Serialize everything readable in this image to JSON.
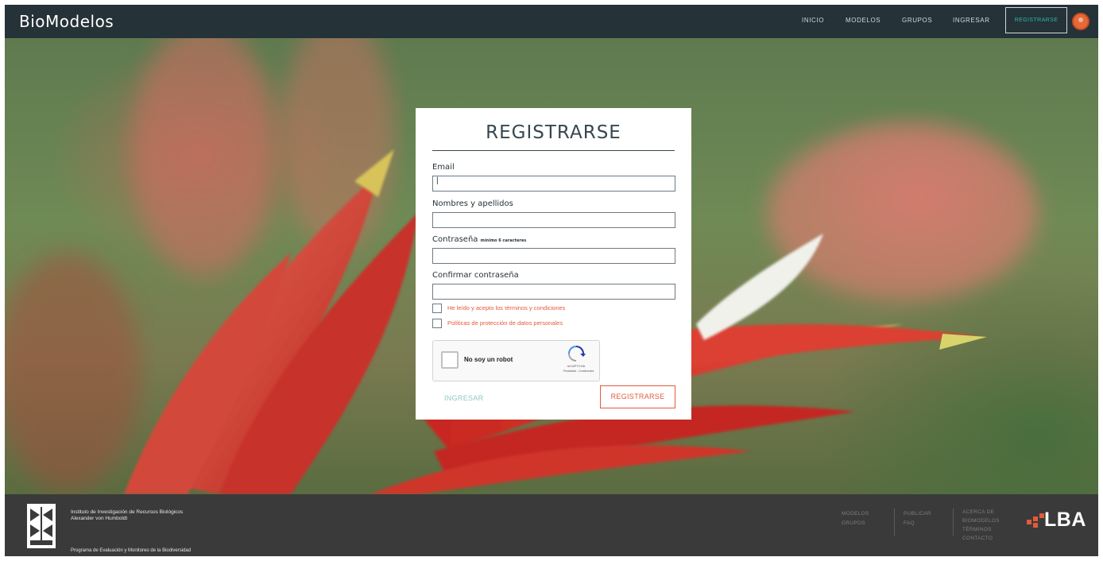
{
  "header": {
    "brand": "BioModelos",
    "nav": {
      "inicio": "INICIO",
      "modelos": "MODELOS",
      "grupos": "GRUPOS",
      "ingresar": "INGRESAR",
      "registrarse": "REGISTRARSE"
    }
  },
  "form": {
    "title": "REGISTRARSE",
    "email_label": "Email",
    "email_value": "|",
    "nombres_label": "Nombres y apellidos",
    "password_label": "Contraseña",
    "password_hint": "mínimo 6 caracteres",
    "confirm_label": "Confirmar contraseña",
    "terms_text": "He leído y acepto los términos y condiciones",
    "privacy_text": "Políticas de protección de datos personales",
    "captcha_text": "No soy un robot",
    "captcha_brand": "reCAPTCHA",
    "captcha_links": "Privacidad - Condiciones",
    "ingresar_link": "INGRESAR",
    "submit_label": "REGISTRARSE"
  },
  "footer": {
    "institute_line1": "Instituto de Investigación de Recursos Biológicos",
    "institute_line2": "Alexander von Humboldt",
    "program": "Programa de Evaluación y Monitoreo de la Biodiversidad",
    "col1": [
      "MODELOS",
      "GRUPOS"
    ],
    "col2": [
      "PUBLICAR",
      "FAQ"
    ],
    "col3": [
      "ACERCA DE",
      "BIOMODELOS",
      "TÉRMINOS",
      "CONTACTO"
    ],
    "logo_text": "LBA"
  },
  "colors": {
    "header_bg": "#253238",
    "footer_bg": "#3a3a3a",
    "accent_red": "#e35a3b",
    "accent_teal": "#2fb3a6"
  },
  "icons": [
    "user-avatar-icon",
    "recaptcha-icon",
    "humboldt-logo",
    "lba-logo"
  ]
}
